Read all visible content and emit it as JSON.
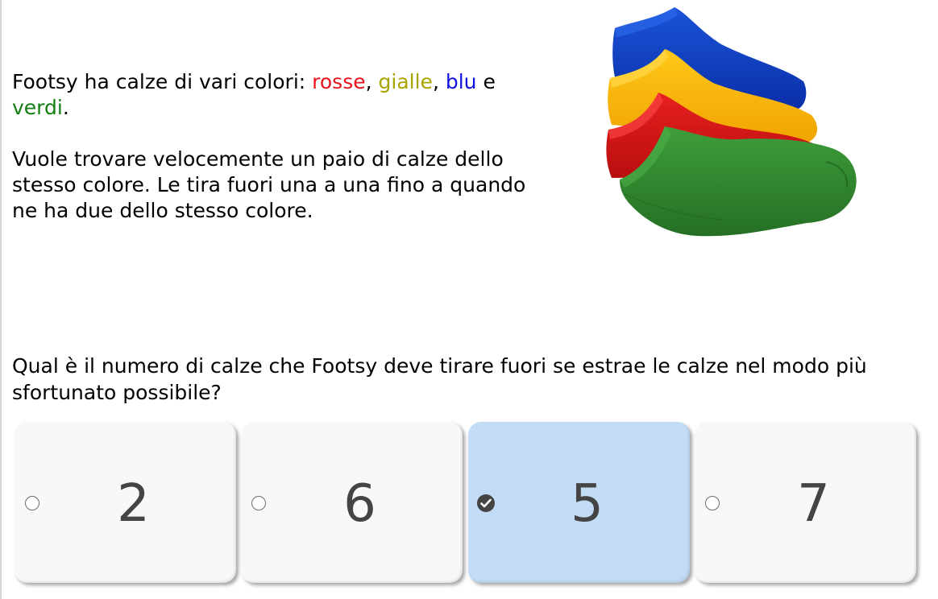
{
  "intro": {
    "p1_before": "Footsy ha calze di vari colori: ",
    "red": "rosse",
    "sep1": ", ",
    "yellow": "gialle",
    "sep2": ", ",
    "blue": "blu",
    "and": " e ",
    "green": "verdi",
    "end": ".",
    "p2": "Vuole trovare velocemente un paio di calze dello stesso colore. Le tira fuori una a una fino a quando ne ha due dello stesso colore."
  },
  "colors": {
    "red": "#e8141b",
    "yellow": "#a9a300",
    "blue": "#1010e0",
    "green": "#128012",
    "selected_bg": "#c1dcf4"
  },
  "illustration": {
    "icon": "socks-illustration",
    "sock_colors": [
      "#0d3fc4",
      "#fbb800",
      "#da1717",
      "#2e8b2e"
    ]
  },
  "question": "Qual è il numero di calze che Footsy deve tirare fuori se estrae le calze nel modo più sfortunato possibile?",
  "options": [
    {
      "label": "2",
      "selected": false
    },
    {
      "label": "6",
      "selected": false
    },
    {
      "label": "5",
      "selected": true
    },
    {
      "label": "7",
      "selected": false
    }
  ]
}
